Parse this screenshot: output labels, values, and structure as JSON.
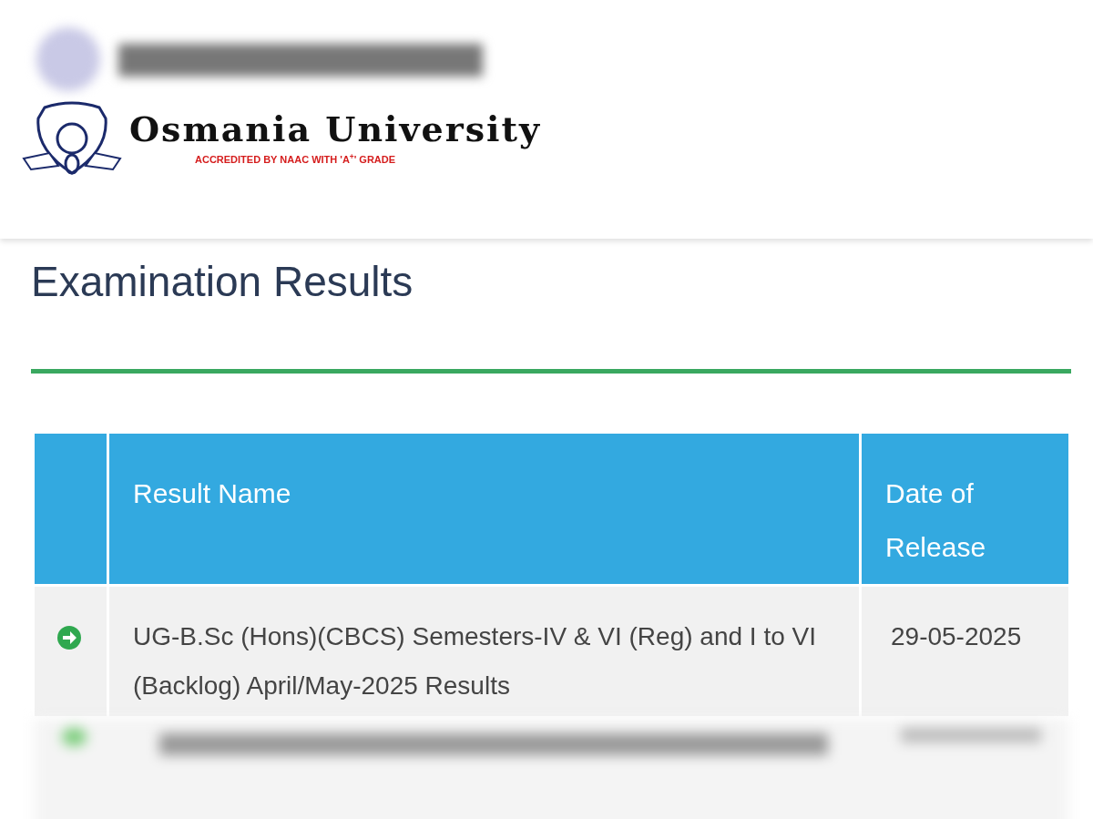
{
  "header": {
    "logo_title": "Osmania University",
    "logo_subtitle": "ACCREDITED BY NAAC WITH 'A$^{+}$' GRADE"
  },
  "page_title": "Examination Results",
  "table": {
    "columns": [
      "",
      "Result Name",
      "Date of Release"
    ],
    "rows": [
      {
        "name": "UG-B.Sc (Hons)(CBCS) Semesters-IV & VI (Reg) and I to VI (Backlog) April/May-2025 Results",
        "date": "29-05-2025"
      }
    ]
  }
}
